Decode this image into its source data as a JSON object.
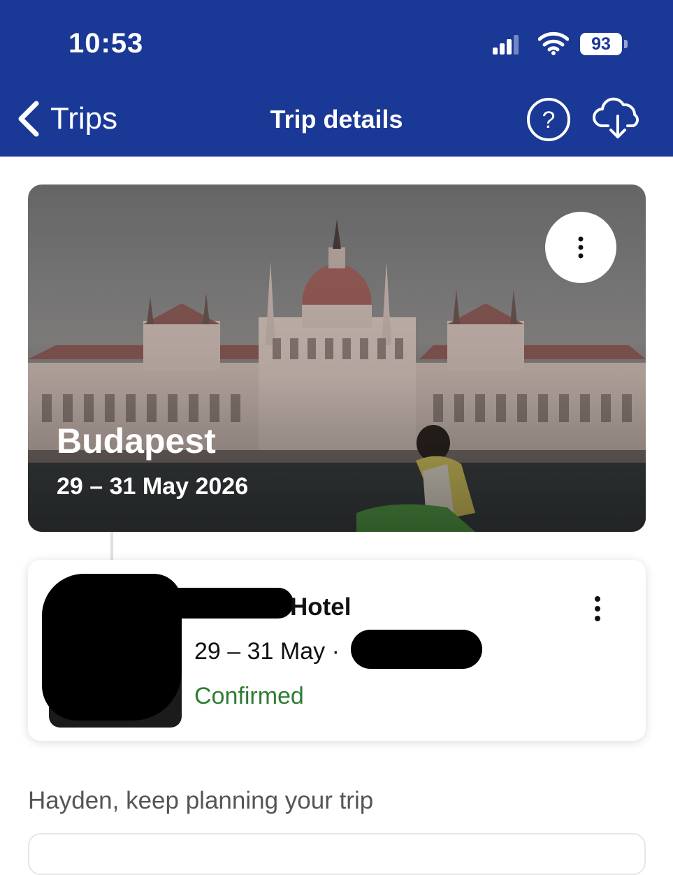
{
  "status_bar": {
    "time": "10:53",
    "battery": "93",
    "icons": [
      "cellular-signal-icon",
      "wifi-icon",
      "battery-icon"
    ]
  },
  "nav": {
    "back_label": "Trips",
    "title": "Trip details",
    "icons": [
      "chevron-left-icon",
      "help-icon",
      "cloud-download-icon"
    ]
  },
  "trip": {
    "destination": "Budapest",
    "dates": "29 – 31 May 2026",
    "more_icon": "more-vertical-icon"
  },
  "booking": {
    "name_visible": "Hotel",
    "dates": "29 – 31 May · ",
    "status": "Confirmed",
    "status_color": "#2e7d32"
  },
  "suggestion": {
    "text": "Hayden, keep planning your trip"
  },
  "colors": {
    "brand": "#1a3895",
    "confirmed": "#2e7d32"
  }
}
